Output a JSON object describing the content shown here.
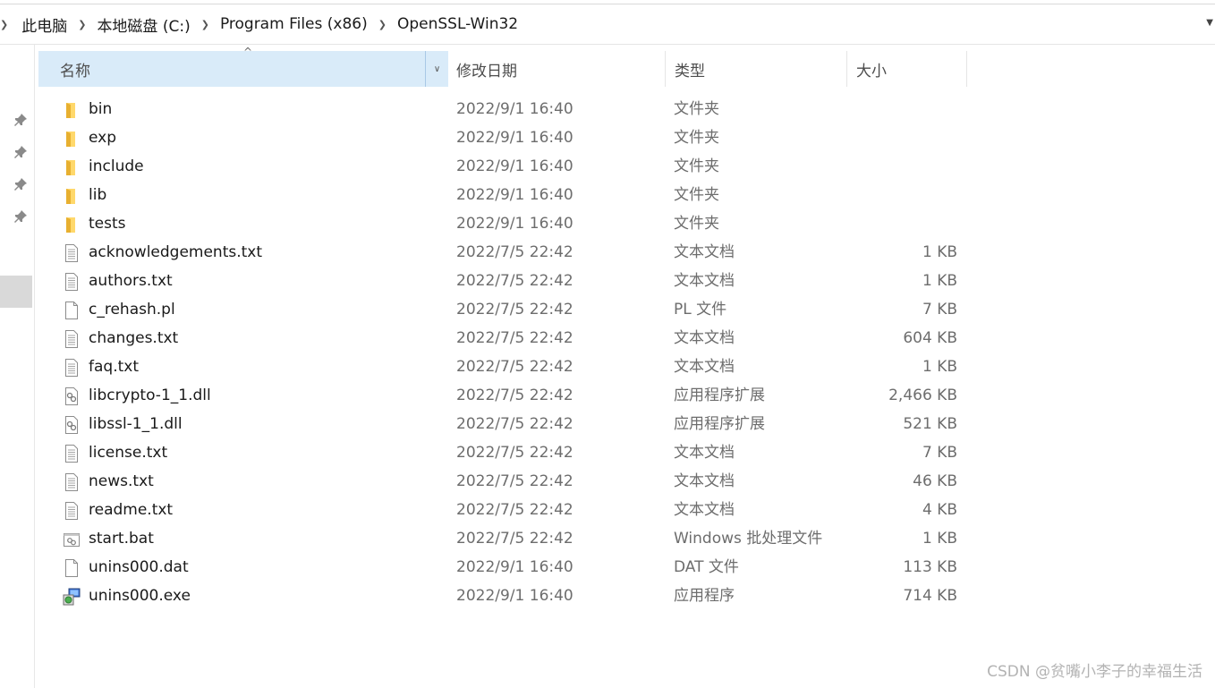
{
  "breadcrumb": [
    "此电脑",
    "本地磁盘 (C:)",
    "Program Files (x86)",
    "OpenSSL-Win32"
  ],
  "columns": {
    "name": "名称",
    "date": "修改日期",
    "type": "类型",
    "size": "大小"
  },
  "files": [
    {
      "name": "bin",
      "date": "2022/9/1 16:40",
      "type": "文件夹",
      "size": "",
      "icon": "folder-icon"
    },
    {
      "name": "exp",
      "date": "2022/9/1 16:40",
      "type": "文件夹",
      "size": "",
      "icon": "folder-icon"
    },
    {
      "name": "include",
      "date": "2022/9/1 16:40",
      "type": "文件夹",
      "size": "",
      "icon": "folder-icon"
    },
    {
      "name": "lib",
      "date": "2022/9/1 16:40",
      "type": "文件夹",
      "size": "",
      "icon": "folder-icon"
    },
    {
      "name": "tests",
      "date": "2022/9/1 16:40",
      "type": "文件夹",
      "size": "",
      "icon": "folder-icon"
    },
    {
      "name": "acknowledgements.txt",
      "date": "2022/7/5 22:42",
      "type": "文本文档",
      "size": "1 KB",
      "icon": "text-file-icon"
    },
    {
      "name": "authors.txt",
      "date": "2022/7/5 22:42",
      "type": "文本文档",
      "size": "1 KB",
      "icon": "text-file-icon"
    },
    {
      "name": "c_rehash.pl",
      "date": "2022/7/5 22:42",
      "type": "PL 文件",
      "size": "7 KB",
      "icon": "blank-file-icon"
    },
    {
      "name": "changes.txt",
      "date": "2022/7/5 22:42",
      "type": "文本文档",
      "size": "604 KB",
      "icon": "text-file-icon"
    },
    {
      "name": "faq.txt",
      "date": "2022/7/5 22:42",
      "type": "文本文档",
      "size": "1 KB",
      "icon": "text-file-icon"
    },
    {
      "name": "libcrypto-1_1.dll",
      "date": "2022/7/5 22:42",
      "type": "应用程序扩展",
      "size": "2,466 KB",
      "icon": "dll-file-icon"
    },
    {
      "name": "libssl-1_1.dll",
      "date": "2022/7/5 22:42",
      "type": "应用程序扩展",
      "size": "521 KB",
      "icon": "dll-file-icon"
    },
    {
      "name": "license.txt",
      "date": "2022/7/5 22:42",
      "type": "文本文档",
      "size": "7 KB",
      "icon": "text-file-icon"
    },
    {
      "name": "news.txt",
      "date": "2022/7/5 22:42",
      "type": "文本文档",
      "size": "46 KB",
      "icon": "text-file-icon"
    },
    {
      "name": "readme.txt",
      "date": "2022/7/5 22:42",
      "type": "文本文档",
      "size": "4 KB",
      "icon": "text-file-icon"
    },
    {
      "name": "start.bat",
      "date": "2022/7/5 22:42",
      "type": "Windows 批处理文件",
      "size": "1 KB",
      "icon": "batch-file-icon"
    },
    {
      "name": "unins000.dat",
      "date": "2022/9/1 16:40",
      "type": "DAT 文件",
      "size": "113 KB",
      "icon": "blank-file-icon"
    },
    {
      "name": "unins000.exe",
      "date": "2022/9/1 16:40",
      "type": "应用程序",
      "size": "714 KB",
      "icon": "installer-icon"
    }
  ],
  "watermark": "CSDN @贫嘴小李子的幸福生活",
  "colors": {
    "header_selected": "#d9ebf9",
    "folder": "#ffc83d",
    "meta_text": "#6d6d6d"
  }
}
